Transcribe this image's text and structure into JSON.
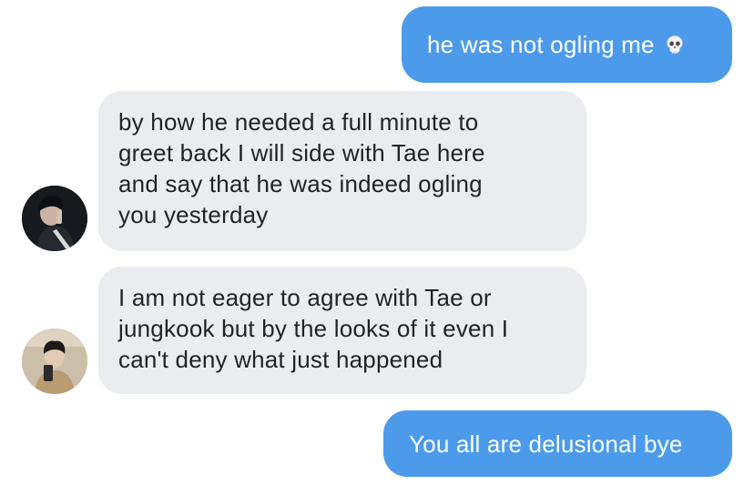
{
  "messages": [
    {
      "sender": "me",
      "text": "he was not ogling me",
      "emoji": "skull-icon"
    },
    {
      "sender": "other",
      "lines": [
        "by how he needed a full minute to",
        "greet back I will side with Tae here",
        "and say that he was indeed ogling",
        "you yesterday"
      ]
    },
    {
      "sender": "other",
      "lines": [
        "I am not eager to agree with Tae or",
        "jungkook but by the looks of it even I",
        "can't deny what just happened"
      ]
    },
    {
      "sender": "me",
      "text": "You all are delusional bye"
    }
  ],
  "colors": {
    "sent_bubble": "#4c9beb",
    "received_bubble": "#eaecef",
    "received_text": "#1f2328"
  }
}
